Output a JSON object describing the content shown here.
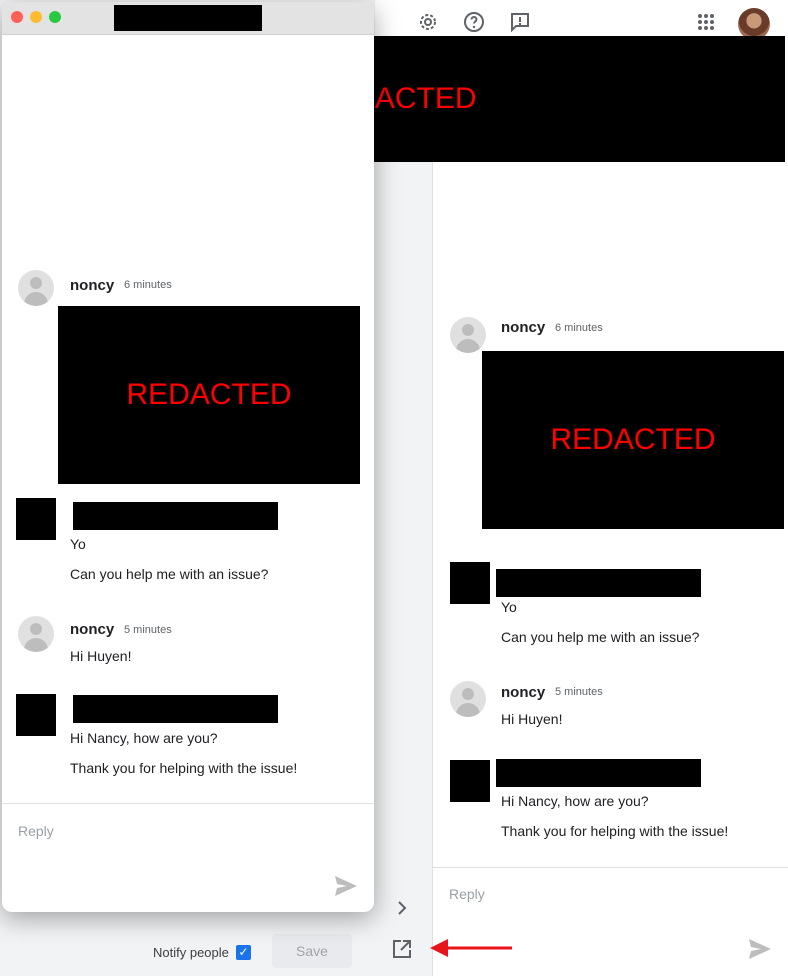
{
  "redacted_label": "REDACTED",
  "left_pane": {
    "comments": [
      {
        "author": "noncy",
        "time": "6 minutes"
      },
      {
        "lines": [
          "Yo",
          "Can you help me with an issue?"
        ]
      },
      {
        "author": "noncy",
        "time": "5 minutes",
        "lines": [
          "Hi Huyen!"
        ]
      },
      {
        "lines": [
          "Hi Nancy, how are you?",
          "Thank you for helping with the issue!"
        ]
      }
    ],
    "reply_placeholder": "Reply"
  },
  "right_pane": {
    "comments": [
      {
        "author": "noncy",
        "time": "6 minutes"
      },
      {
        "lines": [
          "Yo",
          "Can you help me with an issue?"
        ]
      },
      {
        "author": "noncy",
        "time": "5 minutes",
        "lines": [
          "Hi Huyen!"
        ]
      },
      {
        "lines": [
          "Hi Nancy, how are you?",
          "Thank you for helping with the issue!"
        ]
      }
    ],
    "reply_placeholder": "Reply"
  },
  "footer": {
    "notify_label": "Notify people",
    "notify_checked": true,
    "save_label": "Save"
  },
  "icons": [
    "settings-icon",
    "help-icon",
    "feedback-icon",
    "apps-icon",
    "account-avatar",
    "send-icon",
    "chevron-right-icon",
    "open-in-new-icon",
    "red-arrow-annotation"
  ],
  "colors": {
    "redacted_text": "#ff0000",
    "checkbox_blue": "#1a73e8",
    "annotation_arrow": "#e8141a"
  }
}
